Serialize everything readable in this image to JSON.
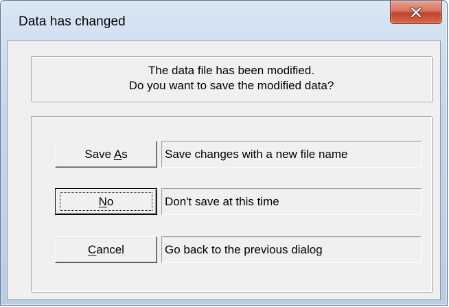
{
  "window": {
    "title": "Data has changed"
  },
  "message": {
    "line1": "The data file has been modified.",
    "line2": "Do you want to save the modified data?"
  },
  "options": [
    {
      "button_label_prefix": "Save ",
      "button_label_mnemonic": "A",
      "button_label_suffix": "s",
      "description": "Save changes with a new file name",
      "is_default": false
    },
    {
      "button_label_prefix": "",
      "button_label_mnemonic": "N",
      "button_label_suffix": "o",
      "description": "Don't save at this time",
      "is_default": true
    },
    {
      "button_label_prefix": "",
      "button_label_mnemonic": "C",
      "button_label_suffix": "ancel",
      "description": "Go back to the previous dialog",
      "is_default": false
    }
  ],
  "colors": {
    "close_button": "#c2442a",
    "dialog_face": "#f0f0f0",
    "frame": "#b9cde5"
  },
  "icons": {
    "close": "close-x-icon"
  }
}
